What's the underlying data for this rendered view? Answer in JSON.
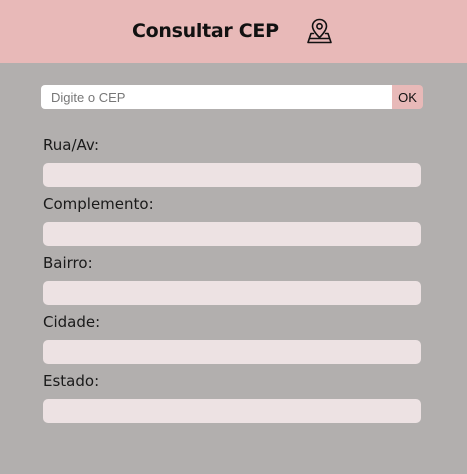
{
  "header": {
    "title": "Consultar CEP",
    "icon": "map-pin-icon",
    "background": "#e8b9b8"
  },
  "search": {
    "placeholder": "Digite o CEP",
    "value": "",
    "button_label": "OK"
  },
  "fields": [
    {
      "label": "Rua/Av:",
      "value": ""
    },
    {
      "label": "Complemento:",
      "value": ""
    },
    {
      "label": "Bairro:",
      "value": ""
    },
    {
      "label": "Cidade:",
      "value": ""
    },
    {
      "label": "Estado:",
      "value": ""
    }
  ],
  "colors": {
    "page_background": "#b2afae",
    "field_background": "#ede2e3",
    "accent": "#e8b9b8"
  }
}
